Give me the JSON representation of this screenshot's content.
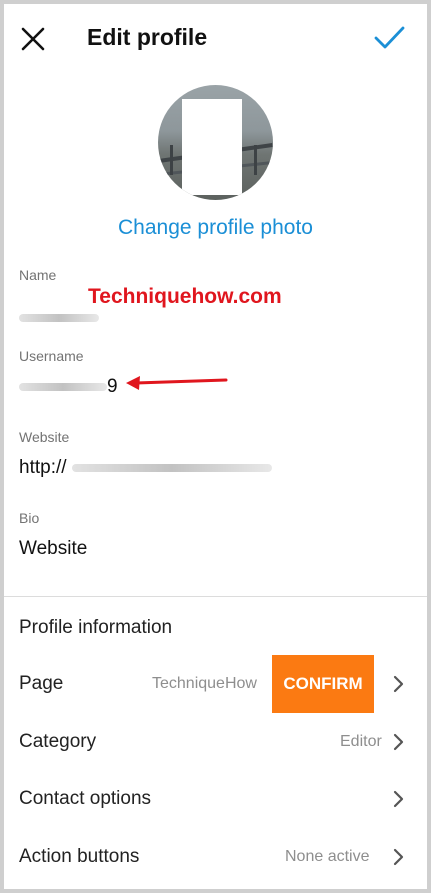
{
  "header": {
    "title": "Edit profile",
    "close_icon": "close-icon",
    "done_icon": "checkmark-icon"
  },
  "profile": {
    "change_photo_label": "Change profile photo",
    "accent_color": "#1b8fd6"
  },
  "fields": {
    "name": {
      "label": "Name",
      "value": ""
    },
    "username": {
      "label": "Username",
      "value": "9"
    },
    "website": {
      "label": "Website",
      "value": "http://"
    },
    "bio": {
      "label": "Bio",
      "value": "Website"
    }
  },
  "watermark": {
    "text": "Techniquehow.com",
    "color": "#e0161e"
  },
  "profile_information": {
    "title": "Profile information",
    "rows": [
      {
        "label": "Page",
        "value": "TechniqueHow"
      },
      {
        "label": "Category",
        "value": "Editor"
      },
      {
        "label": "Contact options",
        "value": ""
      },
      {
        "label": "Action buttons",
        "value": "None active"
      }
    ],
    "confirm_label": "CONFIRM",
    "confirm_color": "#fb7a12"
  }
}
